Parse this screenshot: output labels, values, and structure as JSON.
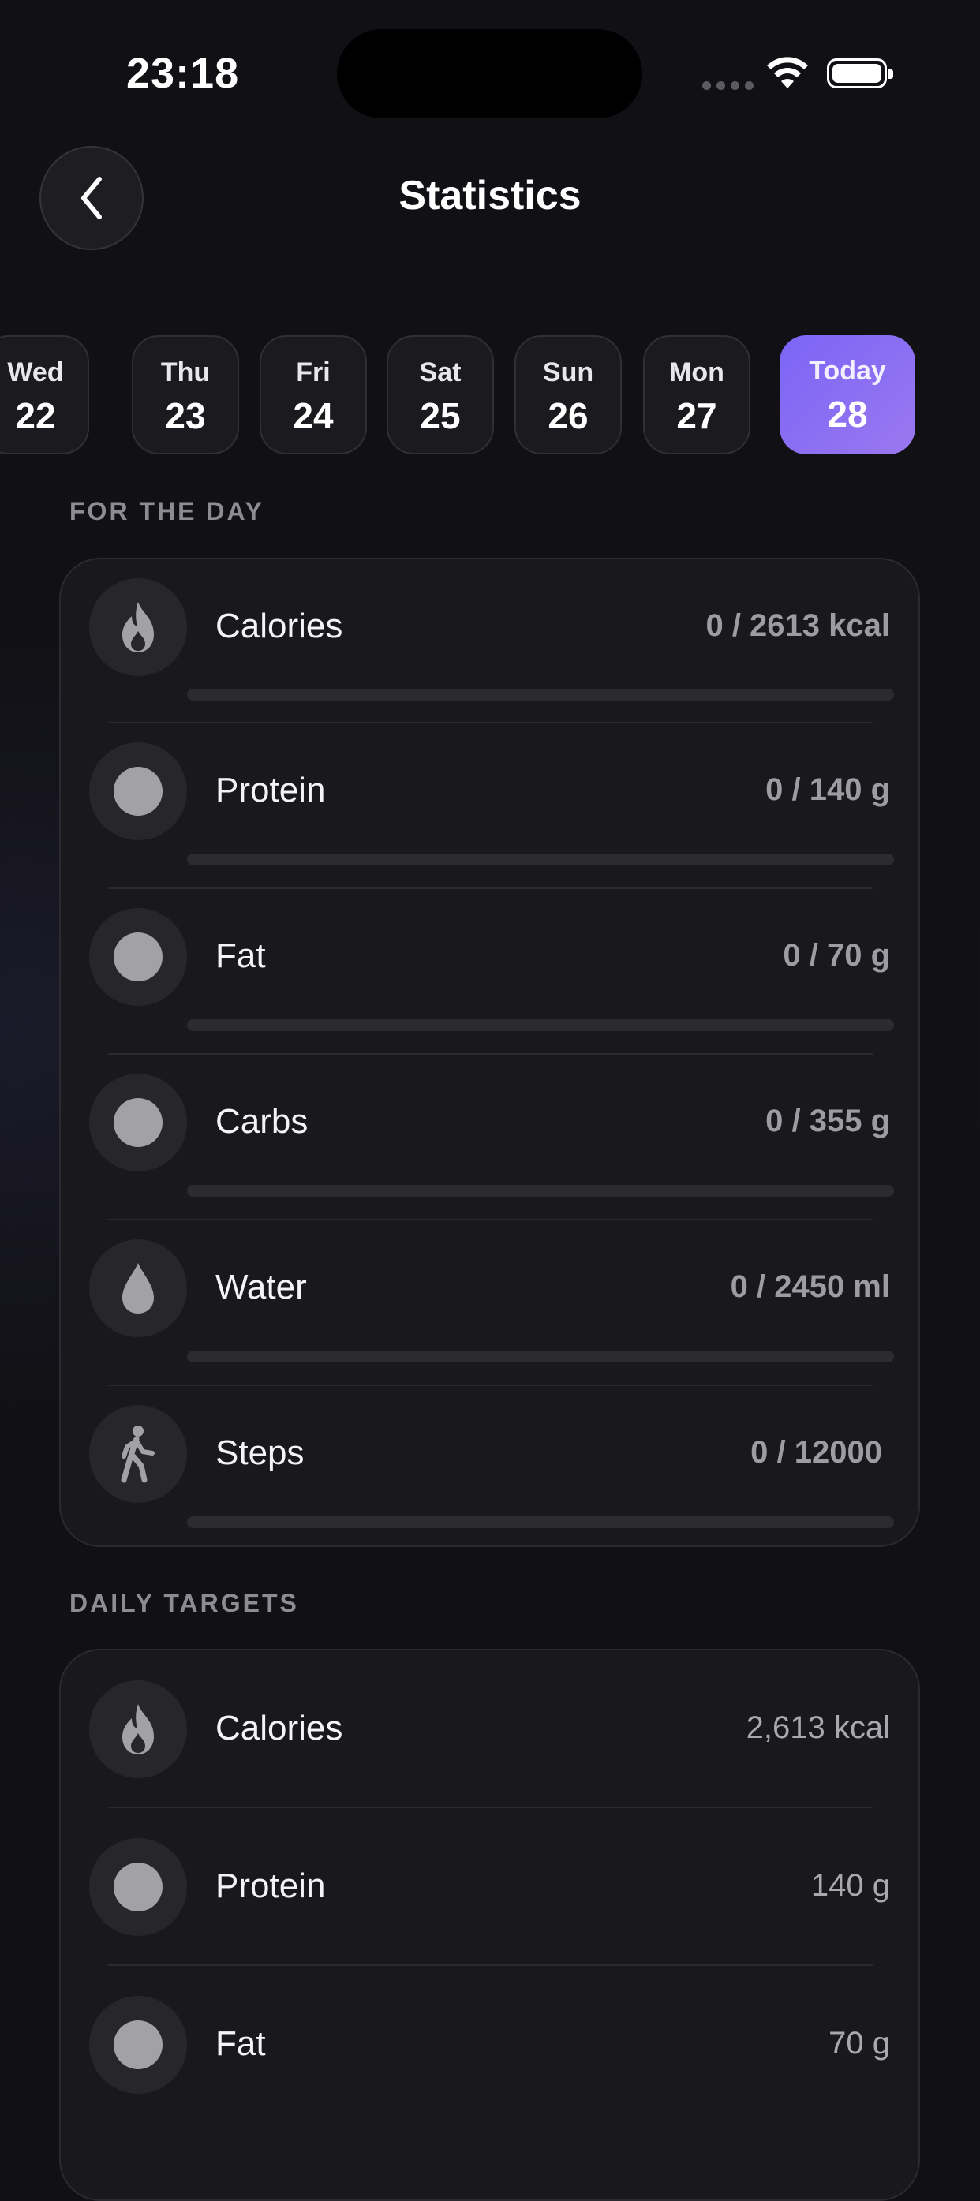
{
  "status_bar": {
    "time": "23:18"
  },
  "header": {
    "title": "Statistics"
  },
  "days": [
    {
      "name": "Wed",
      "date": "22"
    },
    {
      "name": "Thu",
      "date": "23"
    },
    {
      "name": "Fri",
      "date": "24"
    },
    {
      "name": "Sat",
      "date": "25"
    },
    {
      "name": "Sun",
      "date": "26"
    },
    {
      "name": "Mon",
      "date": "27"
    },
    {
      "name": "Today",
      "date": "28",
      "active": true
    }
  ],
  "for_the_day": {
    "title": "FOR THE DAY",
    "items": [
      {
        "label": "Calories",
        "value": "0 / 2613 kcal",
        "icon": "flame-icon",
        "progress": 0
      },
      {
        "label": "Protein",
        "value": "0 / 140 g",
        "icon": "dot-icon",
        "progress": 0
      },
      {
        "label": "Fat",
        "value": "0 / 70 g",
        "icon": "dot-icon",
        "progress": 0
      },
      {
        "label": "Carbs",
        "value": "0 / 355 g",
        "icon": "dot-icon",
        "progress": 0
      },
      {
        "label": "Water",
        "value": "0 / 2450 ml",
        "icon": "water-drop-icon",
        "progress": 0
      },
      {
        "label": "Steps",
        "value": "0 / 12000",
        "icon": "walking-icon",
        "progress": 0
      }
    ]
  },
  "daily_targets": {
    "title": "DAILY TARGETS",
    "items": [
      {
        "label": "Calories",
        "value": "2,613 kcal",
        "icon": "flame-icon"
      },
      {
        "label": "Protein",
        "value": "140 g",
        "icon": "dot-icon"
      },
      {
        "label": "Fat",
        "value": "70 g",
        "icon": "dot-icon"
      }
    ]
  },
  "colors": {
    "accent": "#7b65f6",
    "background": "#111115",
    "card": "#19191d"
  }
}
